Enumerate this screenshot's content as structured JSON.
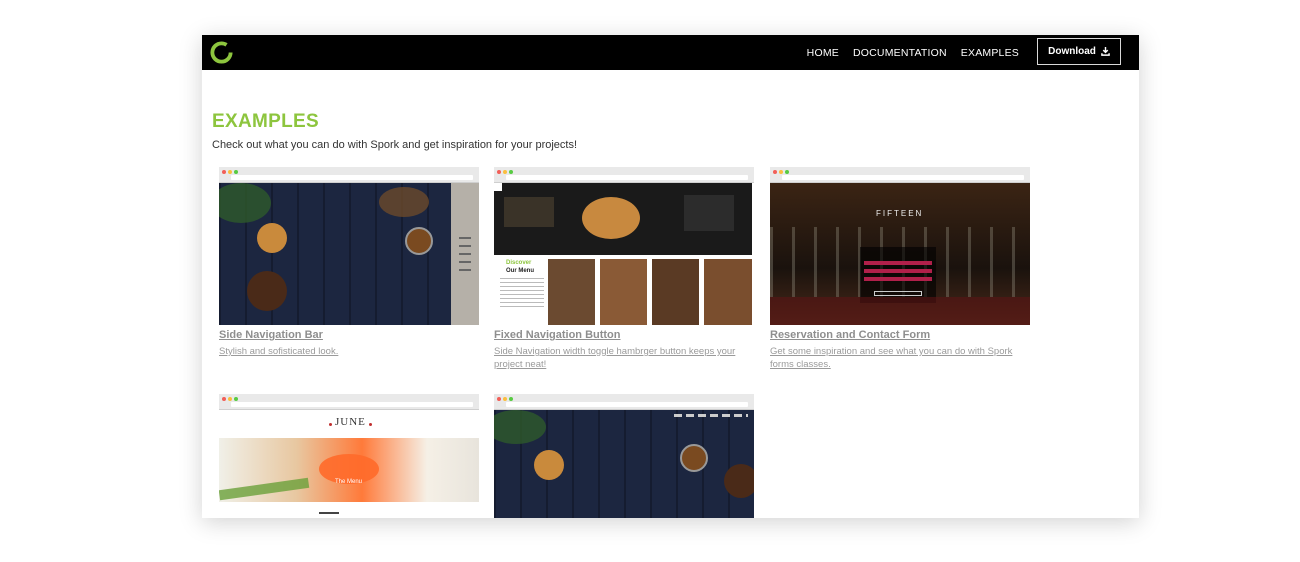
{
  "nav": {
    "links": [
      "HOME",
      "DOCUMENTATION",
      "EXAMPLES"
    ],
    "download_label": "Download"
  },
  "page": {
    "title": "EXAMPLES",
    "subtitle": "Check out what you can do with Spork and get inspiration for your projects!"
  },
  "examples": [
    {
      "title": "Side Navigation Bar",
      "description": "Stylish and sofisticated look."
    },
    {
      "title": "Fixed Navigation Button",
      "description": "Side Navigation width toggle hambrger button keeps your project neat!"
    },
    {
      "title": "Reservation and Contact Form",
      "description": "Get some inspiration and see what you can do with Spork forms classes."
    },
    {
      "title": "",
      "description": ""
    },
    {
      "title": "",
      "description": ""
    }
  ],
  "thumb_text": {
    "discover": "Discover",
    "our_menu": "Our Menu",
    "fifteen": "FIFTEEN",
    "june": "JUNE",
    "the_menu": "The Menu"
  },
  "colors": {
    "accent": "#8dc53e",
    "nav_bg": "#000000"
  }
}
